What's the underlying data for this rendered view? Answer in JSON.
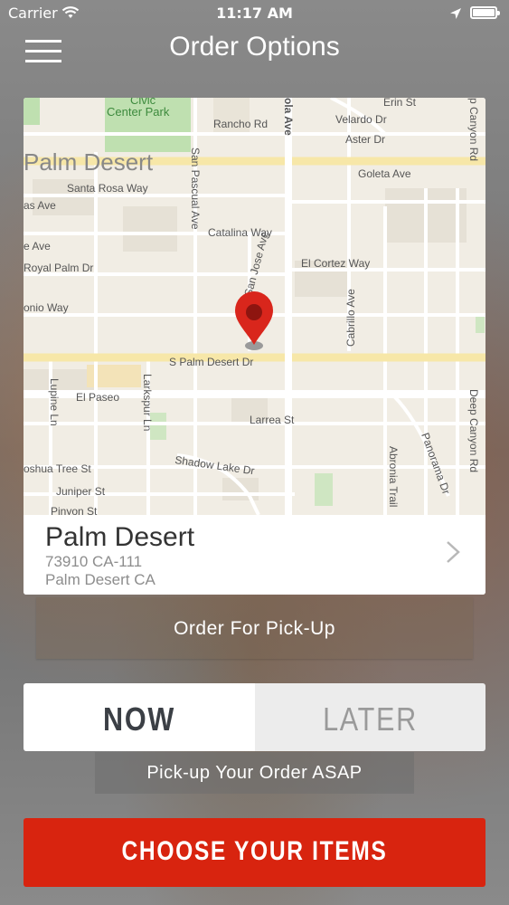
{
  "status_bar": {
    "carrier": "Carrier",
    "time": "11:17 AM"
  },
  "header": {
    "title": "Order Options"
  },
  "map": {
    "labels": {
      "civic": "Civic",
      "center_park": "Center Park",
      "palm_desert_city": "Palm Desert",
      "rancho_rd": "Rancho Rd",
      "erin_st": "Erin St",
      "velardo_dr": "Velardo Dr",
      "aster_dr": "Aster Dr",
      "goleta_ave": "Goleta Ave",
      "santa_rosa_way": "Santa Rosa Way",
      "as_ave": "as Ave",
      "catalina_way": "Catalina Way",
      "e_ave": "e Ave",
      "royal_palm_dr": "Royal Palm Dr",
      "el_cortez_way": "El Cortez Way",
      "onio_way": "onio Way",
      "s_palm_desert_dr": "S Palm Desert Dr",
      "el_paseo": "El Paseo",
      "larrea_st": "Larrea St",
      "oshua_tree_st": "oshua Tree St",
      "shadow_lake_dr": "Shadow Lake Dr",
      "juniper_st": "Juniper St",
      "pinyon_st": "Pinyon St",
      "san_pascual_ave": "San Pascual Ave",
      "ola_ave": "ola Ave",
      "san_jose_ave": "San Jose Ave",
      "cabrillo_ave": "Cabrillo Ave",
      "lupine_ln": "Lupine Ln",
      "larkspur_ln": "Larkspur Ln",
      "abronia_trail": "Abronia Trail",
      "panorama_dr": "Panorama Dr",
      "deep_canyon_rd": "Deep Canyon Rd",
      "p_canyon_rd": "p Canyon Rd"
    },
    "marker_color": "#d9261c"
  },
  "location": {
    "name": "Palm Desert",
    "address_line1": "73910 CA-111",
    "address_line2": "Palm Desert CA"
  },
  "order_type": {
    "label": "Order For Pick-Up"
  },
  "timing": {
    "now_label": "NOW",
    "later_label": "LATER",
    "selected": "NOW",
    "description": "Pick-up Your Order ASAP"
  },
  "cta": {
    "label": "CHOOSE YOUR ITEMS",
    "color": "#d8240f"
  }
}
